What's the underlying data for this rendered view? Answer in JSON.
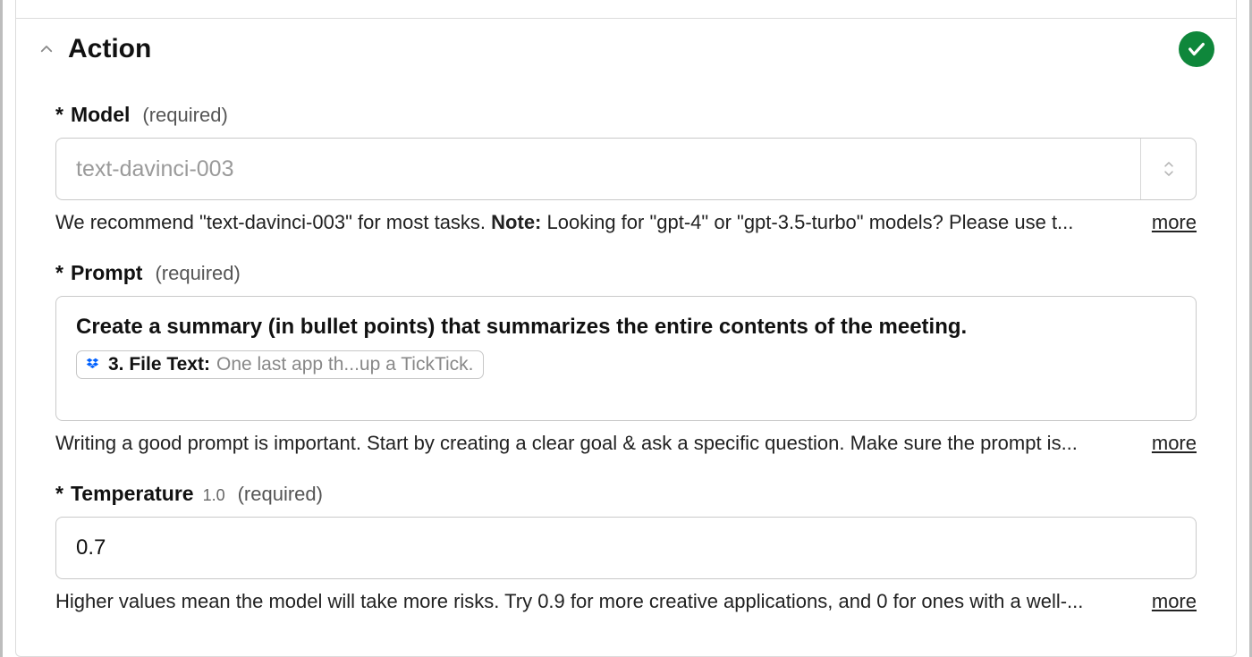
{
  "section": {
    "title": "Action",
    "status": "success"
  },
  "fields": {
    "model": {
      "label": "Model",
      "required_text": "(required)",
      "value": "text-davinci-003",
      "help_pre": "We recommend \"text-davinci-003\" for most tasks. ",
      "help_strong": "Note:",
      "help_post": " Looking for \"gpt-4\" or \"gpt-3.5-turbo\" models? Please use t...",
      "more": "more"
    },
    "prompt": {
      "label": "Prompt",
      "required_text": "(required)",
      "instruction": "Create a summary (in bullet points) that summarizes the entire contents of the meeting.",
      "pill_name": "3. File Text:",
      "pill_value": "One last app th...up a TickTick.",
      "help": "Writing a good prompt is important. Start by creating a clear goal & ask a specific question. Make sure the prompt is...",
      "more": "more"
    },
    "temperature": {
      "label": "Temperature",
      "default": "1.0",
      "required_text": "(required)",
      "value": "0.7",
      "help": "Higher values mean the model will take more risks. Try 0.9 for more creative applications, and 0 for ones with a well-...",
      "more": "more"
    }
  },
  "asterisk": "*"
}
